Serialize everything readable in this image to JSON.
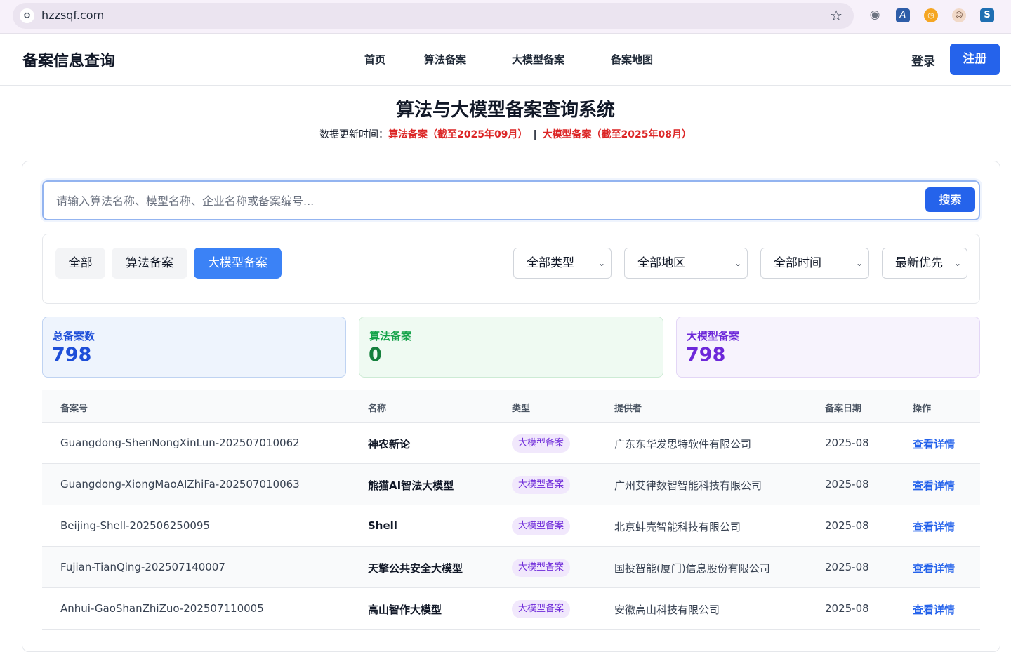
{
  "browser": {
    "url": "hzzsqf.com",
    "extensions": [
      "camera-icon",
      "a-extension-icon",
      "clock-extension-icon",
      "avatar-extension-icon",
      "s-extension-icon"
    ]
  },
  "header": {
    "logo": "备案信息查询",
    "nav": [
      "首页",
      "算法备案",
      "大模型备案",
      "备案地图"
    ],
    "login": "登录",
    "register": "注册"
  },
  "hero": {
    "title": "算法与大模型备案查询系统",
    "update_prefix": "数据更新时间：",
    "algo_update": "算法备案（截至2025年09月）",
    "sep": "|",
    "model_update": "大模型备案（截至2025年08月）"
  },
  "search": {
    "placeholder": "请输入算法名称、模型名称、企业名称或备案编号...",
    "value": "",
    "button": "搜索"
  },
  "filters": {
    "chips": [
      "全部",
      "算法备案",
      "大模型备案"
    ],
    "active_chip": "大模型备案",
    "type_select": "全部类型",
    "region_select": "全部地区",
    "time_select": "全部时间",
    "sort_select": "最新优先"
  },
  "stats": {
    "total_label": "总备案数",
    "total_value": "798",
    "algo_label": "算法备案",
    "algo_value": "0",
    "model_label": "大模型备案",
    "model_value": "798"
  },
  "table": {
    "headers": [
      "备案号",
      "名称",
      "类型",
      "提供者",
      "备案日期",
      "操作"
    ],
    "rows": [
      {
        "id": "Guangdong-ShenNongXinLun-202507010062",
        "name": "神农新论",
        "type": "大模型备案",
        "provider": "广东东华发思特软件有限公司",
        "date": "2025-08",
        "action": "查看详情"
      },
      {
        "id": "Guangdong-XiongMaoAIZhiFa-202507010063",
        "name": "熊猫AI智法大模型",
        "type": "大模型备案",
        "provider": "广州艾律数智智能科技有限公司",
        "date": "2025-08",
        "action": "查看详情"
      },
      {
        "id": "Beijing-Shell-202506250095",
        "name": "Shell",
        "type": "大模型备案",
        "provider": "北京蚌壳智能科技有限公司",
        "date": "2025-08",
        "action": "查看详情"
      },
      {
        "id": "Fujian-TianQing-202507140007",
        "name": "天擎公共安全大模型",
        "type": "大模型备案",
        "provider": "国投智能(厦门)信息股份有限公司",
        "date": "2025-08",
        "action": "查看详情"
      },
      {
        "id": "Anhui-GaoShanZhiZuo-202507110005",
        "name": "高山智作大模型",
        "type": "大模型备案",
        "provider": "安徽高山科技有限公司",
        "date": "2025-08",
        "action": "查看详情"
      }
    ]
  },
  "colors": {
    "primary": "#2563eb",
    "accent_red": "#dc2626",
    "model_purple": "#6d28d9",
    "algo_green": "#16a34a"
  }
}
